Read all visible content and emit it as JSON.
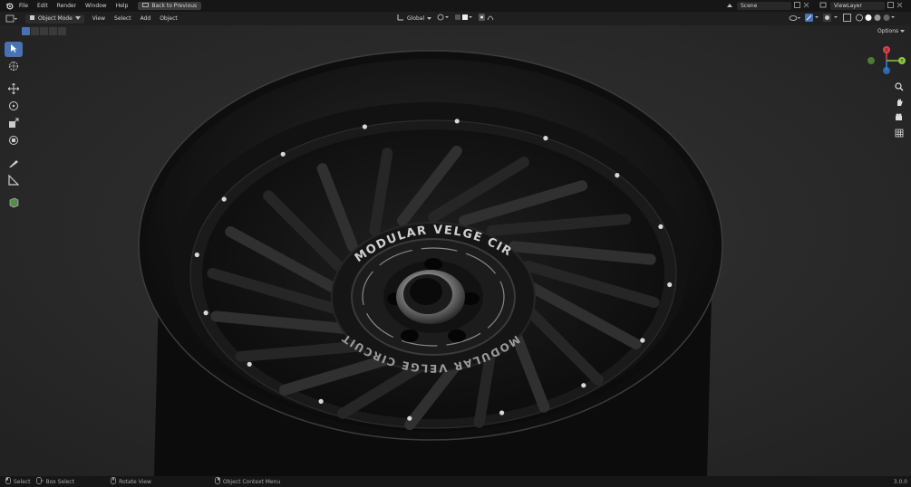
{
  "topbar": {
    "menus": [
      "File",
      "Edit",
      "Render",
      "Window",
      "Help"
    ],
    "back_button": "Back to Previous",
    "scene": "Scene",
    "view_layer": "ViewLayer"
  },
  "header": {
    "mode": "Object Mode",
    "menus": [
      "View",
      "Select",
      "Add",
      "Object"
    ],
    "orientation": "Global",
    "options": "Options"
  },
  "wheel_text": {
    "top": "MODULAR VELGE CIRCUIT",
    "bottom": "MODULAR VELGE CIRCUIT"
  },
  "gizmo": {
    "x": "X",
    "y": "Y",
    "z": "Z"
  },
  "statusbar": {
    "select": "Select",
    "box_select": "Box Select",
    "rotate_view": "Rotate View",
    "context_menu": "Object Context Menu",
    "version": "3.0.0"
  },
  "colors": {
    "accent": "#4772b3",
    "axis_x": "#e0414f",
    "axis_y": "#8dc63f",
    "axis_z": "#2f86e6"
  },
  "icons": {
    "tools": [
      "select-box-icon",
      "cursor-icon",
      "move-icon",
      "rotate-icon",
      "scale-icon",
      "transform-icon",
      "annotate-icon",
      "measure-icon",
      "add-cube-icon"
    ],
    "nav": [
      "zoom-icon",
      "pan-icon",
      "camera-icon",
      "grid-icon"
    ]
  }
}
